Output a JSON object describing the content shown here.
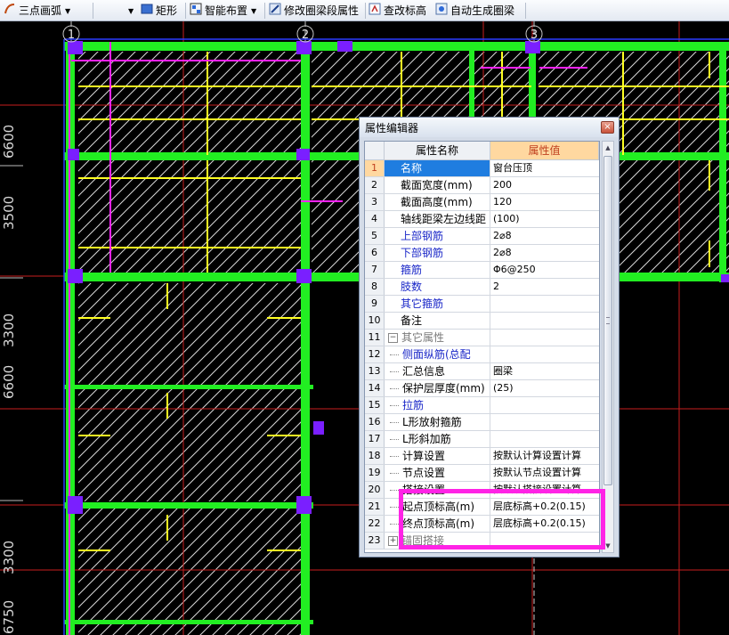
{
  "toolbar": {
    "arc_tool": "三点画弧",
    "rect_tool": "矩形",
    "smart_layout": "智能布置",
    "modify_beam_props": "修改圈梁段属性",
    "edit_elevation": "查改标高",
    "auto_generate_ringbeam": "自动生成圈梁"
  },
  "drawing": {
    "axis_labels": [
      "1",
      "2",
      "3"
    ],
    "dimensions": [
      "6600",
      "3500",
      "3300",
      "6600",
      "3300",
      "6750"
    ]
  },
  "property_editor": {
    "title": "属性编辑器",
    "close_symbol": "×",
    "header_name": "属性名称",
    "header_value": "属性值",
    "rows": [
      {
        "num": "1",
        "name": "名称",
        "value": "窗台压顶"
      },
      {
        "num": "2",
        "name": "截面宽度(mm)",
        "value": "200"
      },
      {
        "num": "3",
        "name": "截面高度(mm)",
        "value": "120"
      },
      {
        "num": "4",
        "name": "轴线距梁左边线距",
        "value": "(100)"
      },
      {
        "num": "5",
        "name": "上部钢筋",
        "value": "2⌀8"
      },
      {
        "num": "6",
        "name": "下部钢筋",
        "value": "2⌀8"
      },
      {
        "num": "7",
        "name": "箍筋",
        "value": "Φ6@250"
      },
      {
        "num": "8",
        "name": "肢数",
        "value": "2"
      },
      {
        "num": "9",
        "name": "其它箍筋",
        "value": ""
      },
      {
        "num": "10",
        "name": "备注",
        "value": ""
      },
      {
        "num": "11",
        "name": "其它属性",
        "value": ""
      },
      {
        "num": "12",
        "name": "侧面纵筋(总配",
        "value": ""
      },
      {
        "num": "13",
        "name": "汇总信息",
        "value": "圈梁"
      },
      {
        "num": "14",
        "name": "保护层厚度(mm)",
        "value": "(25)"
      },
      {
        "num": "15",
        "name": "拉筋",
        "value": ""
      },
      {
        "num": "16",
        "name": "L形放射箍筋",
        "value": ""
      },
      {
        "num": "17",
        "name": "L形斜加筋",
        "value": ""
      },
      {
        "num": "18",
        "name": "计算设置",
        "value": "按默认计算设置计算"
      },
      {
        "num": "19",
        "name": "节点设置",
        "value": "按默认节点设置计算"
      },
      {
        "num": "20",
        "name": "搭接设置",
        "value": "按默认搭接设置计算"
      },
      {
        "num": "21",
        "name": "起点顶标高(m)",
        "value": "层底标高+0.2(0.15)"
      },
      {
        "num": "22",
        "name": "终点顶标高(m)",
        "value": "层底标高+0.2(0.15)"
      },
      {
        "num": "23",
        "name": "锚固搭接",
        "value": ""
      }
    ]
  },
  "colors": {
    "beam_green": "#22ee22",
    "hatch": "#d8d8d8",
    "magenta": "#ff22ff",
    "yellow": "#ffff22",
    "red_grid": "#c81e1e",
    "column_purple": "#7a1fff",
    "highlight": "#ff23e6"
  }
}
